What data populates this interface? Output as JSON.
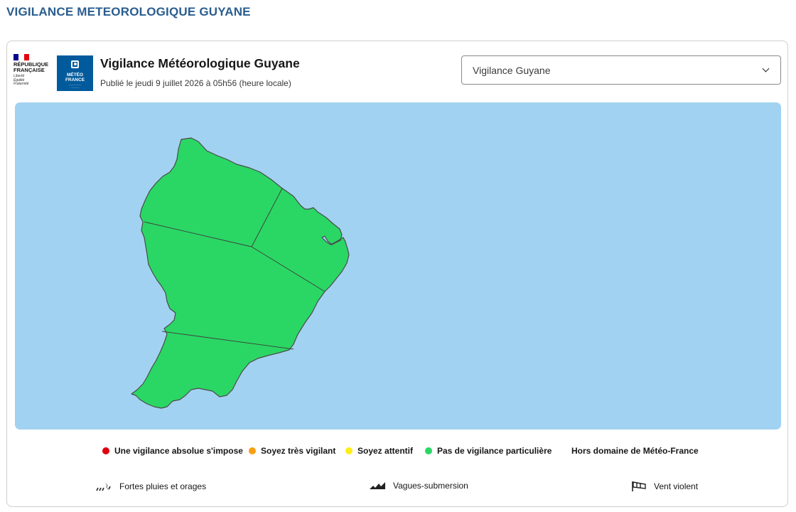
{
  "page_title": "VIGILANCE METEOROLOGIQUE GUYANE",
  "logos": {
    "republique_text": [
      "RÉPUBLIQUE",
      "FRANÇAISE"
    ],
    "republique_motto": [
      "Liberté",
      "Égalité",
      "Fraternité"
    ],
    "meteo_france_text": [
      "MÉTÉO",
      "FRANCE"
    ],
    "meteo_france_icon": "meteo-france-icon",
    "flag_colors": [
      "#000091",
      "#ffffff",
      "#e1000f"
    ]
  },
  "header": {
    "title": "Vigilance Météorologique Guyane",
    "published": "Publié le jeudi 9 juillet 2026 à 05h56 (heure locale)"
  },
  "region_select": {
    "value": "Vigilance Guyane",
    "icon": "chevron-down-icon"
  },
  "map": {
    "sea_color": "#a2d2f1",
    "zones": [
      {
        "id": "nord-ouest",
        "level": "vert"
      },
      {
        "id": "nord-est",
        "level": "vert"
      },
      {
        "id": "centre",
        "level": "vert"
      },
      {
        "id": "sud",
        "level": "vert"
      }
    ],
    "green_color": "#2ad764"
  },
  "legend": [
    {
      "label": "Une vigilance absolue s'impose",
      "color": "#e1000f"
    },
    {
      "label": "Soyez très vigilant",
      "color": "#f7a014"
    },
    {
      "label": "Soyez attentif",
      "color": "#ffee14"
    },
    {
      "label": "Pas de vigilance particulière",
      "color": "#2ad764"
    },
    {
      "label": "Hors domaine de Météo-France",
      "color": null
    }
  ],
  "phenomena": [
    {
      "label": "Fortes pluies et orages",
      "icon": "rain-storm-icon"
    },
    {
      "label": "Vagues-submersion",
      "icon": "waves-icon"
    },
    {
      "label": "Vent violent",
      "icon": "windsock-icon"
    }
  ]
}
